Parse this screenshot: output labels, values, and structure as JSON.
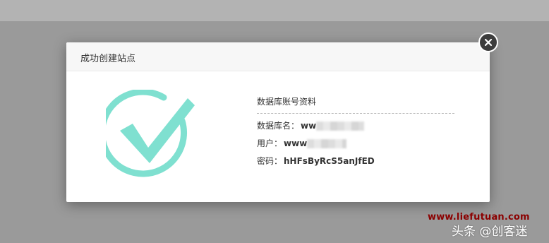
{
  "dialog": {
    "title": "成功创建站点",
    "info_title": "数据库账号资料",
    "db_name_label": "数据库名：",
    "db_name_value": "ww",
    "user_label": "用户：",
    "user_value": "www",
    "password_label": "密码：",
    "password_value": "hHFsByRcS5anJfED",
    "success_icon": "checkmark-circle-icon",
    "close_icon": "close-icon",
    "accent_color": "#7fe0d0"
  },
  "watermark": {
    "url": "www.liefutuan.com",
    "brand": "头条 @创客迷"
  }
}
